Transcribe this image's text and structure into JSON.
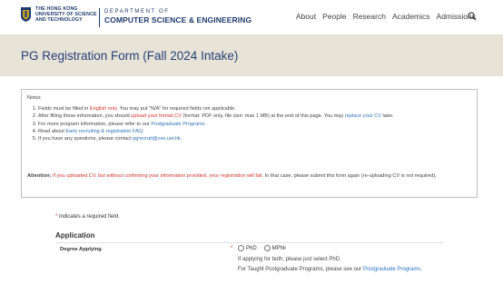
{
  "header": {
    "university_lines": [
      "THE HONG KONG",
      "UNIVERSITY OF SCIENCE",
      "AND TECHNOLOGY"
    ],
    "dept_line1": "DEPARTMENT OF",
    "dept_line2": "COMPUTER SCIENCE & ENGINEERING",
    "nav": [
      "About",
      "People",
      "Research",
      "Academics",
      "Admissions"
    ],
    "search_icon": "search-icon"
  },
  "page": {
    "title": "PG Registration Form (Fall 2024 Intake)"
  },
  "notes": {
    "title": "Notes",
    "item1": {
      "a": "Fields must be filled in ",
      "red": "English only",
      "b": ". You may put \"N/A\" for required fields not applicable."
    },
    "item2": {
      "a": "After filling these information, you should ",
      "red": "upload your formal CV",
      "b": " (format: PDF only, file size: max 1 MB) at the end of this page. You may ",
      "link": "replace your CV",
      "c": " later."
    },
    "item3": {
      "a": "For more program information, please refer to our ",
      "link": "Postgraduate Programs",
      "b": "."
    },
    "item4": {
      "a": "Read about ",
      "link": "Early recruiting & registration FAQ",
      "b": "."
    },
    "item5": {
      "a": "If you have any questions, please contact ",
      "link": "pgrecruit@cse.ust.hk",
      "b": "."
    },
    "attention": {
      "label": "Attention:",
      "red": " If you uploaded CV, but without confirming your information provided, your registration will fail.",
      "b": " In that case, please submit this form again (re-uploading CV is not required)."
    }
  },
  "form": {
    "required_note_star": "*",
    "required_note": " indicates a required field.",
    "section_title": "Application",
    "degree_label": "Degree Applying",
    "degree_star": "*",
    "options": [
      "PhD",
      "MPhil"
    ],
    "help1": "If applying for both, please just select PhD.",
    "help2_a": "For Taught Postgraduate Programs, please see our ",
    "help2_link": "Postgraduate Programs",
    "help2_b": "."
  },
  "colors": {
    "brand_navy": "#243f78",
    "band": "#e8e3d7",
    "required_red": "#d0332b",
    "link_blue": "#2a72b8"
  }
}
